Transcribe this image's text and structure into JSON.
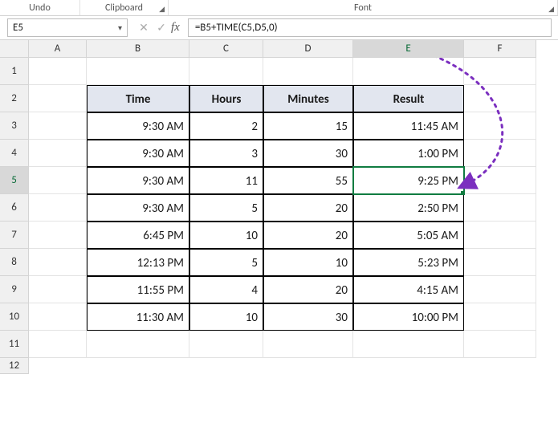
{
  "ribbon": {
    "undo": "Undo",
    "clipboard": "Clipboard",
    "font": "Font"
  },
  "namebox": {
    "value": "E5"
  },
  "formula_bar": {
    "cancel_icon": "✕",
    "confirm_icon": "✓",
    "fx_label": "fx",
    "value": "=B5+TIME(C5,D5,0)"
  },
  "columns": [
    "A",
    "B",
    "C",
    "D",
    "E",
    "F"
  ],
  "row_numbers": [
    "1",
    "2",
    "3",
    "4",
    "5",
    "6",
    "7",
    "8",
    "9",
    "10",
    "11",
    "12"
  ],
  "headers": {
    "B": "Time",
    "C": "Hours",
    "D": "Minutes",
    "E": "Result"
  },
  "rows": [
    {
      "B": "9:30 AM",
      "C": "2",
      "D": "15",
      "E": "11:45 AM"
    },
    {
      "B": "9:30 AM",
      "C": "3",
      "D": "30",
      "E": "1:00 PM"
    },
    {
      "B": "9:30 AM",
      "C": "11",
      "D": "55",
      "E": "9:25 PM"
    },
    {
      "B": "9:30 AM",
      "C": "5",
      "D": "20",
      "E": "2:50 PM"
    },
    {
      "B": "6:45 PM",
      "C": "10",
      "D": "20",
      "E": "5:05 AM"
    },
    {
      "B": "12:13 PM",
      "C": "5",
      "D": "10",
      "E": "5:23 PM"
    },
    {
      "B": "11:55 PM",
      "C": "4",
      "D": "20",
      "E": "4:15 AM"
    },
    {
      "B": "11:30 AM",
      "C": "10",
      "D": "30",
      "E": "10:00 PM"
    }
  ],
  "selected_cell": "E5",
  "selected_row": "5",
  "selected_col": "E"
}
